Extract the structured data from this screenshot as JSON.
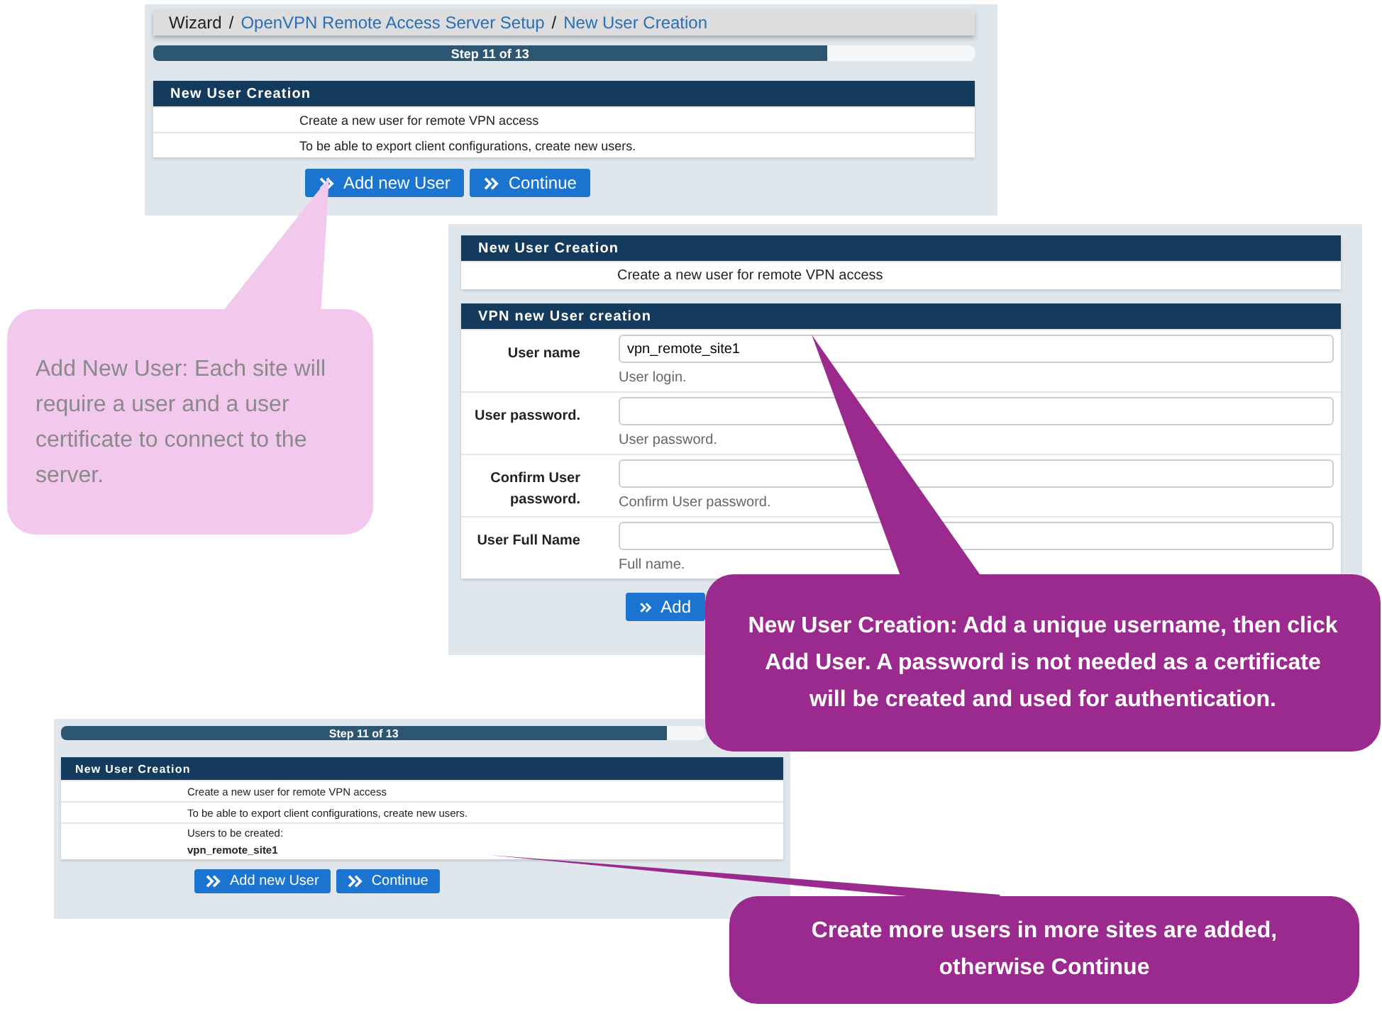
{
  "wizard_panel": {
    "breadcrumb": [
      {
        "label": "Wizard",
        "kind": "text",
        "separator": "/"
      },
      {
        "label": "OpenVPN Remote Access Server Setup",
        "kind": "link",
        "separator": "/"
      },
      {
        "label": "New User Creation",
        "kind": "link"
      }
    ],
    "progress": {
      "label": "Step 11 of 13",
      "level": 0.82
    },
    "section": {
      "title": "New User Creation",
      "rows": [
        {
          "text": "Create a new user for remote VPN access"
        },
        {
          "text": "To be able to export client configurations, create new users."
        }
      ]
    },
    "buttons": [
      {
        "label": "Add new User"
      },
      {
        "label": "Continue"
      }
    ]
  },
  "user_form_panel": {
    "intro_section": {
      "title": "New User Creation",
      "rows": [
        {
          "text": "Create a new user for remote VPN access"
        }
      ]
    },
    "form_section": {
      "title": "VPN new User creation",
      "fields": [
        {
          "label": "User name",
          "value": "vpn_remote_site1",
          "hint": "User login."
        },
        {
          "label": "User password.",
          "hint": "User password."
        },
        {
          "label": "Confirm User password.",
          "hint": "Confirm User password."
        },
        {
          "label": "User Full Name",
          "hint": "Full name."
        }
      ]
    },
    "buttons": [
      {
        "label": "Add"
      }
    ]
  },
  "summary_panel": {
    "progress": {
      "label": "Step 11 of 13",
      "level": 0.94
    },
    "section": {
      "title": "New User Creation",
      "rows": [
        {
          "text": "Create a new user for remote VPN access"
        },
        {
          "text": "To be able to export client configurations, create new users."
        },
        {
          "text": "Users to be created:",
          "detail": "vpn_remote_site1"
        }
      ]
    },
    "buttons": [
      {
        "label": "Add new User"
      },
      {
        "label": "Continue"
      }
    ]
  },
  "callouts": [
    {
      "kind": "soft",
      "text": "Add New User: Each site will require a user and a user certificate to connect to the server."
    },
    {
      "kind": "strong",
      "text": "New User Creation: Add a unique username, then click Add User. A password is not needed as a certificate will be created and used for authentication."
    },
    {
      "kind": "strong",
      "text": "Create more users in more sites are added, otherwise Continue"
    }
  ]
}
